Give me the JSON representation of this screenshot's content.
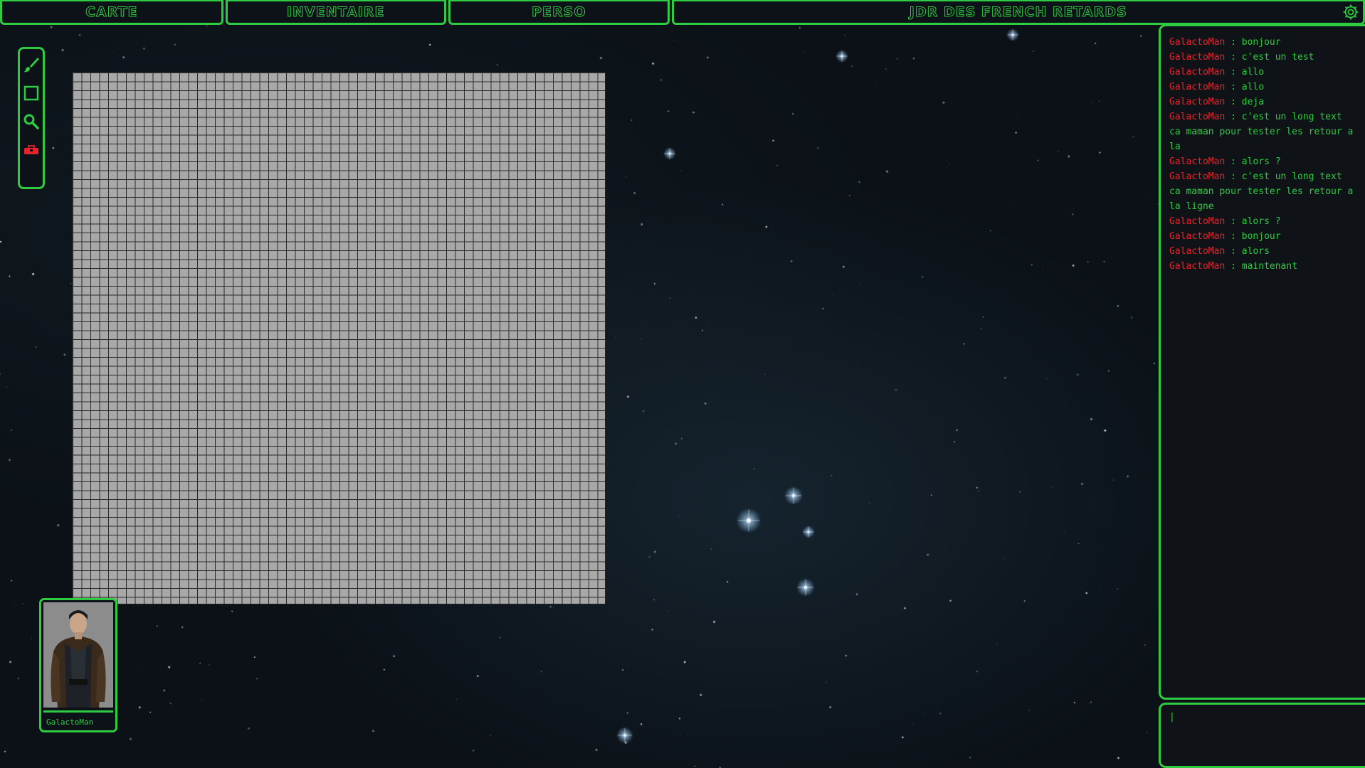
{
  "nav": {
    "tabs": [
      {
        "label": "CARTE"
      },
      {
        "label": "INVENTAIRE"
      },
      {
        "label": "PERSO"
      }
    ],
    "title": "JDR DES FRENCH RETARDS"
  },
  "tools": [
    {
      "icon": "brush-icon"
    },
    {
      "icon": "square-icon"
    },
    {
      "icon": "zoom-icon"
    },
    {
      "icon": "toolbox-icon"
    }
  ],
  "character": {
    "name": "GalactoMan"
  },
  "chat": {
    "messages": [
      {
        "user": "GalactoMan",
        "text": "bonjour"
      },
      {
        "user": "GalactoMan",
        "text": "c'est un test"
      },
      {
        "user": "GalactoMan",
        "text": "allo"
      },
      {
        "user": "GalactoMan",
        "text": "allo"
      },
      {
        "user": "GalactoMan",
        "text": "deja"
      },
      {
        "user": "GalactoMan",
        "text": "c'est un long text ca maman pour tester les retour a la"
      },
      {
        "user": "GalactoMan",
        "text": "alors ?"
      },
      {
        "user": "GalactoMan",
        "text": "c'est un long text ca maman pour tester les retour a la ligne"
      },
      {
        "user": "GalactoMan",
        "text": "alors ?"
      },
      {
        "user": "GalactoMan",
        "text": "bonjour"
      },
      {
        "user": "GalactoMan",
        "text": "alors"
      },
      {
        "user": "GalactoMan",
        "text": "maintenant"
      }
    ],
    "separator": " : ",
    "input_value": "|"
  },
  "colors": {
    "accent": "#2ecc40",
    "username": "#e8222a",
    "background": "#0b1117",
    "map_fill": "#a8a8a8"
  }
}
